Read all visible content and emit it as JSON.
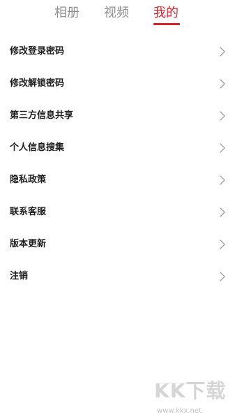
{
  "tabs": [
    {
      "label": "相册",
      "active": false
    },
    {
      "label": "视频",
      "active": false
    },
    {
      "label": "我的",
      "active": true
    }
  ],
  "menu": [
    {
      "label": "修改登录密码",
      "icon": "chevron-right-icon"
    },
    {
      "label": "修改解锁密码",
      "icon": "chevron-right-icon"
    },
    {
      "label": "第三方信息共享",
      "icon": "chevron-right-icon"
    },
    {
      "label": "个人信息搜集",
      "icon": "chevron-right-icon"
    },
    {
      "label": "隐私政策",
      "icon": "chevron-right-icon"
    },
    {
      "label": "联系客服",
      "icon": "chevron-right-icon"
    },
    {
      "label": "版本更新",
      "icon": "chevron-right-icon"
    },
    {
      "label": "注销",
      "icon": "chevron-right-icon"
    }
  ],
  "watermark": {
    "logo": "KK下载",
    "url": "www.kkx.net"
  },
  "colors": {
    "accent": "#d9212a",
    "tab_inactive": "#8f8f8f",
    "text": "#1e1e1e",
    "chevron": "#a0a0a0",
    "background": "#ffffff"
  }
}
